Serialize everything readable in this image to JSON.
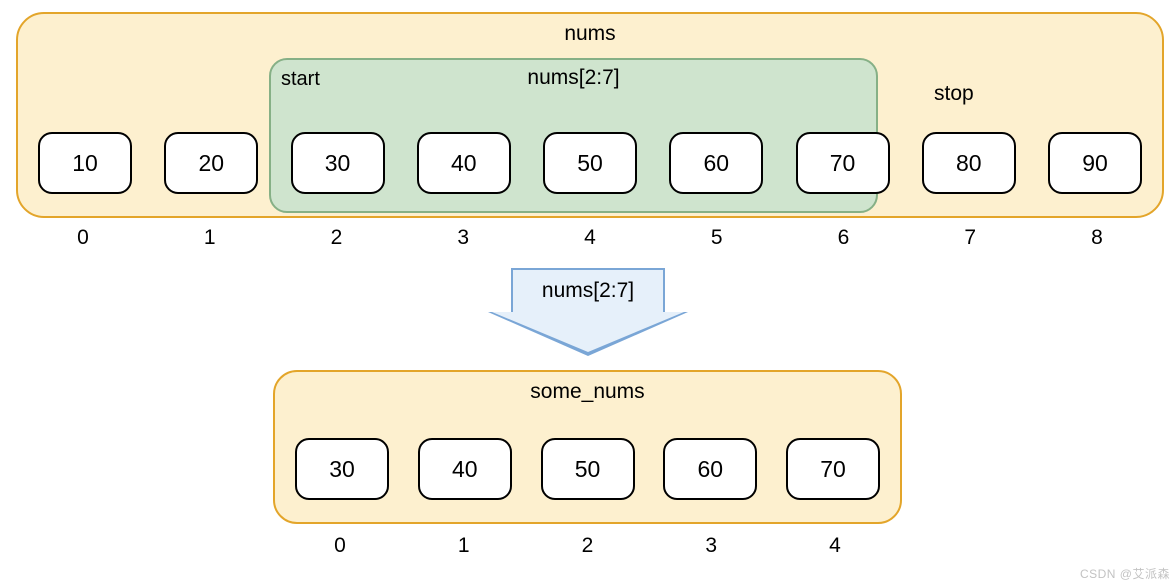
{
  "source": {
    "name": "nums",
    "items": [
      {
        "value": "10",
        "index": "0"
      },
      {
        "value": "20",
        "index": "1"
      },
      {
        "value": "30",
        "index": "2"
      },
      {
        "value": "40",
        "index": "3"
      },
      {
        "value": "50",
        "index": "4"
      },
      {
        "value": "60",
        "index": "5"
      },
      {
        "value": "70",
        "index": "6"
      },
      {
        "value": "80",
        "index": "7"
      },
      {
        "value": "90",
        "index": "8"
      }
    ],
    "slice_label": "nums[2:7]",
    "start_label": "start",
    "stop_label": "stop"
  },
  "arrow_label": "nums[2:7]",
  "result": {
    "name": "some_nums",
    "items": [
      {
        "value": "30",
        "index": "0"
      },
      {
        "value": "40",
        "index": "1"
      },
      {
        "value": "50",
        "index": "2"
      },
      {
        "value": "60",
        "index": "3"
      },
      {
        "value": "70",
        "index": "4"
      }
    ]
  },
  "watermark": "CSDN @艾派森"
}
